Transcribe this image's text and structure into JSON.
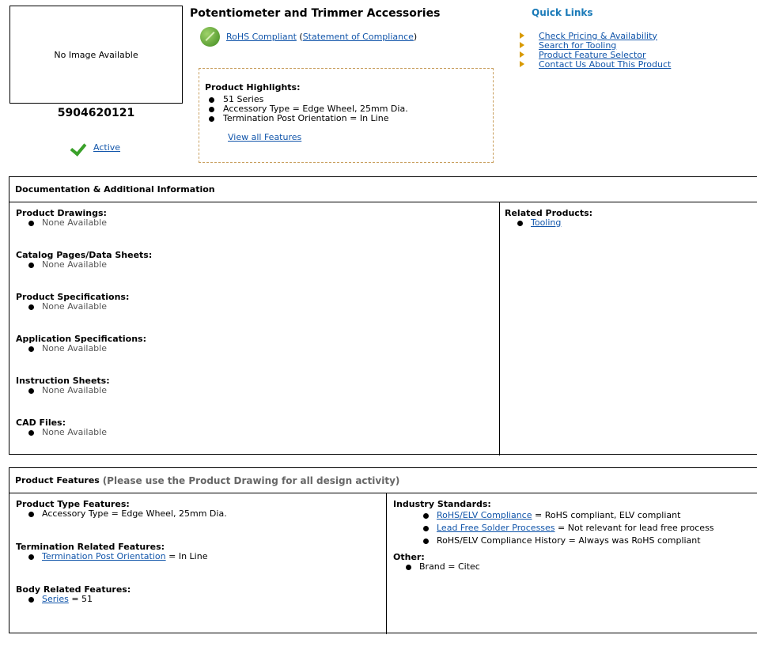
{
  "product": {
    "image_text": "No Image Available",
    "part_number": "5904620121",
    "status": "Active",
    "title": "Potentiometer and Trimmer Accessories",
    "rohs": {
      "link": "RoHS Compliant",
      "open": "(",
      "statement": "Statement of Compliance",
      "close": ")"
    }
  },
  "highlights": {
    "title": "Product Highlights:",
    "items": [
      "51 Series",
      "Accessory Type = Edge Wheel, 25mm Dia.",
      "Termination Post Orientation = In Line"
    ],
    "view_all": "View all Features"
  },
  "quick_links": {
    "title": "Quick Links",
    "items": [
      "Check Pricing & Availability",
      "Search for Tooling",
      "Product Feature Selector",
      "Contact Us About This Product"
    ]
  },
  "documentation": {
    "header": "Documentation & Additional Information",
    "sections": [
      {
        "title": "Product Drawings:",
        "item": "None Available"
      },
      {
        "title": "Catalog Pages/Data Sheets:",
        "item": "None Available"
      },
      {
        "title": "Product Specifications:",
        "item": "None Available"
      },
      {
        "title": "Application Specifications:",
        "item": "None Available"
      },
      {
        "title": "Instruction Sheets:",
        "item": "None Available"
      },
      {
        "title": "CAD Files:",
        "item": "None Available"
      }
    ],
    "related": {
      "title": "Related Products:",
      "item": "Tooling"
    }
  },
  "features": {
    "header": "Product Features",
    "header_note": "(Please use the Product Drawing for all design activity)",
    "product_type": {
      "title": "Product Type Features:",
      "item": "Accessory Type = Edge Wheel, 25mm Dia."
    },
    "termination": {
      "title": "Termination Related Features:",
      "link": "Termination Post Orientation",
      "value": " = In Line"
    },
    "body": {
      "title": "Body Related Features:",
      "link": "Series",
      "value": " = 51"
    },
    "industry": {
      "title": "Industry Standards:",
      "items": [
        {
          "link": "RoHS/ELV Compliance",
          "value": " = RoHS compliant, ELV compliant"
        },
        {
          "link": "Lead Free Solder Processes",
          "value": " = Not relevant for lead free process"
        },
        {
          "link": "",
          "value": "RoHS/ELV Compliance History = Always was RoHS compliant"
        }
      ]
    },
    "other": {
      "title": "Other:",
      "item": "Brand = Citec"
    }
  }
}
